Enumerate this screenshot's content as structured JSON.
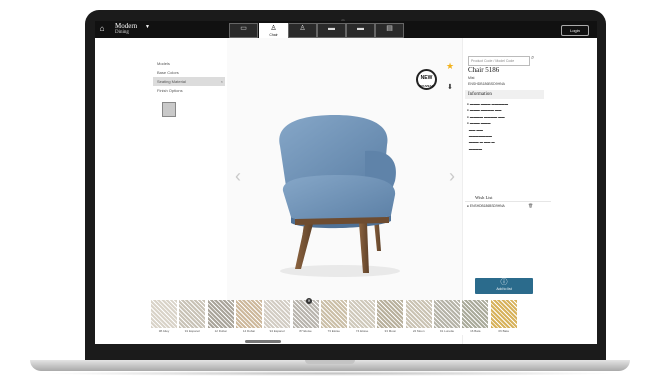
{
  "app": {
    "brand_title": "Modern",
    "brand_subtitle": "Dining",
    "login_label": "Login"
  },
  "tabs": [
    {
      "label": "",
      "icon": "sofa-icon"
    },
    {
      "label": "Chair",
      "icon": "chair-icon",
      "active": true
    },
    {
      "label": "",
      "icon": "stool-icon"
    },
    {
      "label": "",
      "icon": "table-icon"
    },
    {
      "label": "",
      "icon": "bench-icon"
    },
    {
      "label": "",
      "icon": "sideboard-icon"
    }
  ],
  "left_menu": {
    "items": [
      "Models",
      "Base Colors",
      "Seating Material",
      "Finish Options"
    ],
    "selected_index": 2,
    "close_glyph": "×"
  },
  "viewer": {
    "prev_glyph": "‹",
    "next_glyph": "›",
    "badge_line1": "NEW",
    "badge_line2": "NOUVEAU",
    "favorite_icon": "star-icon",
    "download_icon": "download-icon"
  },
  "product": {
    "search_placeholder": "Product Code / Model Code",
    "title": "Chair 5186",
    "subtitle": "Mist",
    "code": "ENSHDB186BSD9HNA",
    "info_heading": "Information",
    "wishlist_heading": "Wish List",
    "wishlist_item": "ENSHDB186BSD9HNA",
    "add_button_label": "Add to list"
  },
  "fabrics": [
    {
      "label": "38 Ailey",
      "color": "#d9d3c8"
    },
    {
      "label": "91 Espanol",
      "color": "#c8c2b6"
    },
    {
      "label": "12 Dubai",
      "color": "#a9a49a"
    },
    {
      "label": "14 Dubai",
      "color": "#cdb89b"
    },
    {
      "label": "94 Espanol",
      "color": "#d2ccc3"
    },
    {
      "label": "87 Eloise",
      "color": "#b8b4ad"
    },
    {
      "label": "73 Eloise",
      "color": "#cbbfa7"
    },
    {
      "label": "74 Eloise",
      "color": "#cfc9bb"
    },
    {
      "label": "33 Moon",
      "color": "#b8b09c"
    },
    {
      "label": "22 Moon",
      "color": "#cac3b3"
    },
    {
      "label": "91 Lunette",
      "color": "#b5b3a7"
    },
    {
      "label": "16 Bata",
      "color": "#a9aa9a"
    },
    {
      "label": "06 Bata",
      "color": "#d7b25b"
    }
  ],
  "colors": {
    "fabric_blue": "#6f93b8",
    "wood": "#7a5636",
    "accent": "#2b6b8c",
    "star": "#f2b21c"
  }
}
